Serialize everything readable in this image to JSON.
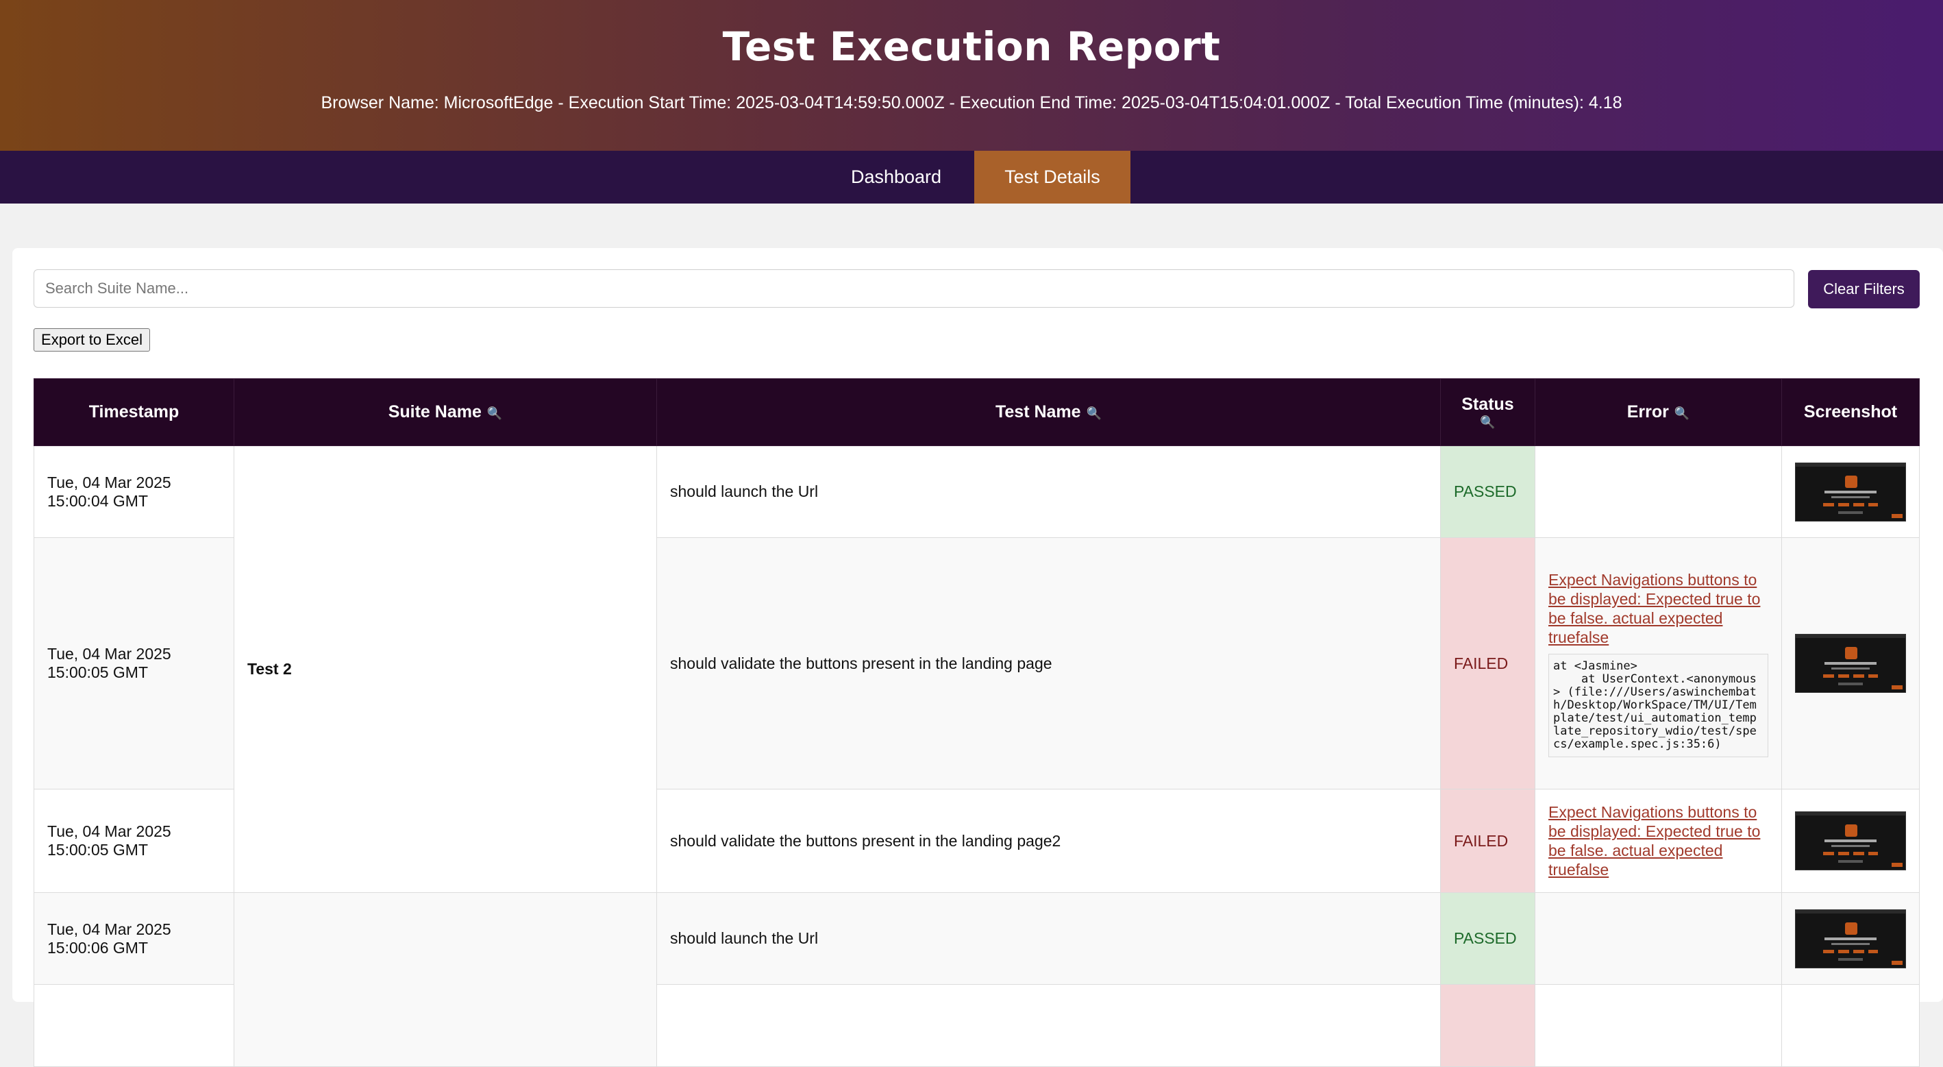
{
  "header": {
    "title": "Test Execution Report",
    "meta": "Browser Name: MicrosoftEdge - Execution Start Time: 2025-03-04T14:59:50.000Z - Execution End Time: 2025-03-04T15:04:01.000Z - Total Execution Time (minutes): 4.18"
  },
  "nav": {
    "dashboard": "Dashboard",
    "test_details": "Test Details"
  },
  "filters": {
    "search_placeholder": "Search Suite Name...",
    "clear": "Clear Filters",
    "export": "Export to Excel"
  },
  "table": {
    "headers": {
      "timestamp": "Timestamp",
      "suite": "Suite Name",
      "test": "Test Name",
      "status": "Status",
      "error": "Error",
      "screenshot": "Screenshot"
    },
    "suite_name": "Test 2",
    "rows": [
      {
        "timestamp": "Tue, 04 Mar 2025 15:00:04 GMT",
        "test": "should launch the Url",
        "status": "PASSED"
      },
      {
        "timestamp": "Tue, 04 Mar 2025 15:00:05 GMT",
        "test": "should validate the buttons present in the landing page",
        "status": "FAILED",
        "error": "Expect Navigations buttons to be displayed: Expected true to be false. actual expected truefalse",
        "stack": "at <Jasmine>\n    at UserContext.<anonymous> (file:///Users/aswinchembath/Desktop/WorkSpace/TM/UI/Template/test/ui_automation_template_repository_wdio/test/specs/example.spec.js:35:6)"
      },
      {
        "timestamp": "Tue, 04 Mar 2025 15:00:05 GMT",
        "test": "should validate the buttons present in the landing page2",
        "status": "FAILED",
        "error": "Expect Navigations buttons to be displayed: Expected true to be false. actual expected truefalse"
      },
      {
        "timestamp": "Tue, 04 Mar 2025 15:00:06 GMT",
        "test": "should launch the Url",
        "status": "PASSED"
      }
    ]
  },
  "colors": {
    "header_gradient_start": "#7a4418",
    "header_gradient_end": "#4a1c6e",
    "nav_bg": "#2a1243",
    "nav_active": "#a9612a",
    "table_header": "#240624",
    "passed_bg": "#d8ecd8",
    "failed_bg": "#f4d6d8"
  }
}
